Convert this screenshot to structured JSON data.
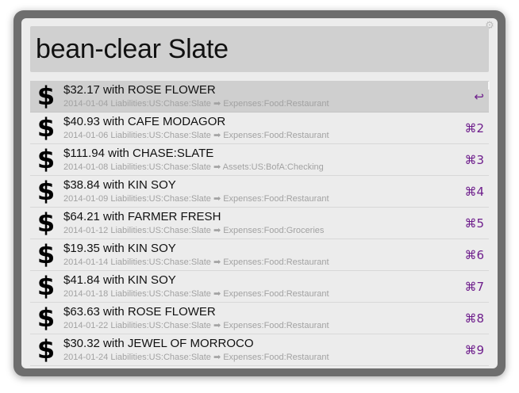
{
  "search": {
    "query": "bean-clear Slate"
  },
  "results": [
    {
      "title": "$32.17 with ROSE FLOWER",
      "subtitle": "2014-01-04 Liabilities:US:Chase:Slate ➡ Expenses:Food:Restaurant",
      "shortcut": "↩",
      "icon": "$"
    },
    {
      "title": "$40.93 with CAFE MODAGOR",
      "subtitle": "2014-01-06 Liabilities:US:Chase:Slate ➡ Expenses:Food:Restaurant",
      "shortcut": "⌘2",
      "icon": "$"
    },
    {
      "title": "$111.94 with CHASE:SLATE",
      "subtitle": "2014-01-08 Liabilities:US:Chase:Slate ➡ Assets:US:BofA:Checking",
      "shortcut": "⌘3",
      "icon": "$"
    },
    {
      "title": "$38.84 with KIN SOY",
      "subtitle": "2014-01-09 Liabilities:US:Chase:Slate ➡ Expenses:Food:Restaurant",
      "shortcut": "⌘4",
      "icon": "$"
    },
    {
      "title": "$64.21 with FARMER FRESH",
      "subtitle": "2014-01-12 Liabilities:US:Chase:Slate ➡ Expenses:Food:Groceries",
      "shortcut": "⌘5",
      "icon": "$"
    },
    {
      "title": "$19.35 with KIN SOY",
      "subtitle": "2014-01-14 Liabilities:US:Chase:Slate ➡ Expenses:Food:Restaurant",
      "shortcut": "⌘6",
      "icon": "$"
    },
    {
      "title": "$41.84 with KIN SOY",
      "subtitle": "2014-01-18 Liabilities:US:Chase:Slate ➡ Expenses:Food:Restaurant",
      "shortcut": "⌘7",
      "icon": "$"
    },
    {
      "title": "$63.63 with ROSE FLOWER",
      "subtitle": "2014-01-22 Liabilities:US:Chase:Slate ➡ Expenses:Food:Restaurant",
      "shortcut": "⌘8",
      "icon": "$"
    },
    {
      "title": "$30.32 with JEWEL OF MORROCO",
      "subtitle": "2014-01-24 Liabilities:US:Chase:Slate ➡ Expenses:Food:Restaurant",
      "shortcut": "⌘9",
      "icon": "$"
    }
  ],
  "selected_index": 0,
  "icons": {
    "settings": "gear-icon",
    "result": "dollar-icon"
  },
  "colors": {
    "shortcut": "#6e1e8c",
    "selected_row": "#cfcfcf",
    "frame": "#6e6e6e"
  }
}
